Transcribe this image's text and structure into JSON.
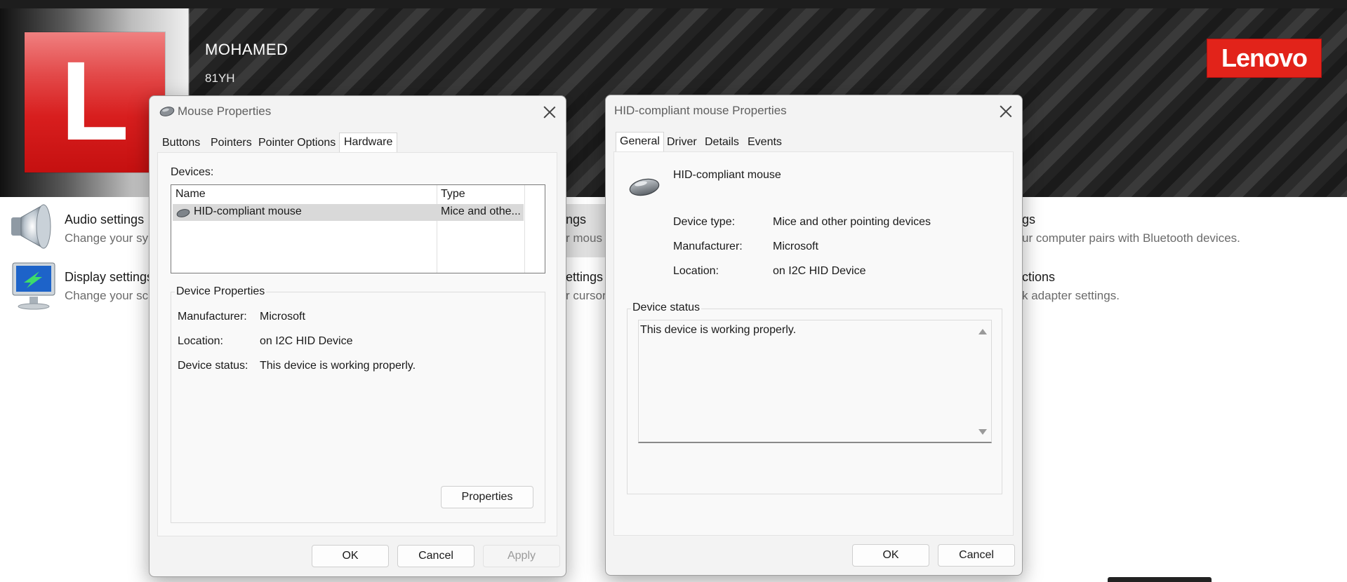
{
  "banner": {
    "logo_letter": "L",
    "pc_name": "MOHAMED",
    "pc_model": "81YH",
    "brand": "Lenovo"
  },
  "settings": {
    "audio": {
      "title": "Audio settings",
      "desc": "Change your sy"
    },
    "display": {
      "title": "Display settings",
      "desc": "Change your sc"
    },
    "mouse": {
      "title_tail": "ngs",
      "desc_tail": "r mous"
    },
    "pointer": {
      "title_tail": "ettings",
      "desc_tail": "r cursor"
    },
    "bluetooth": {
      "title_tail": "gs",
      "desc_tail": "ur computer pairs with Bluetooth devices."
    },
    "network": {
      "title_tail": "ctions",
      "desc_tail": "k adapter settings."
    }
  },
  "mouse_dialog": {
    "title": "Mouse Properties",
    "tabs": [
      "Buttons",
      "Pointers",
      "Pointer Options",
      "Hardware"
    ],
    "active_tab": "Hardware",
    "devices_label": "Devices:",
    "columns": [
      "Name",
      "Type"
    ],
    "rows": [
      {
        "name": "HID-compliant mouse",
        "type": "Mice and othe..."
      }
    ],
    "group_title": "Device Properties",
    "props": [
      {
        "label": "Manufacturer:",
        "value": "Microsoft"
      },
      {
        "label": "Location:",
        "value": "on I2C HID Device"
      },
      {
        "label": "Device status:",
        "value": "This device is working properly."
      }
    ],
    "properties_button": "Properties",
    "ok": "OK",
    "cancel": "Cancel",
    "apply": "Apply"
  },
  "hid_dialog": {
    "title": "HID-compliant mouse Properties",
    "tabs": [
      "General",
      "Driver",
      "Details",
      "Events"
    ],
    "active_tab": "General",
    "device_name": "HID-compliant mouse",
    "props": [
      {
        "label": "Device type:",
        "value": "Mice and other pointing devices"
      },
      {
        "label": "Manufacturer:",
        "value": "Microsoft"
      },
      {
        "label": "Location:",
        "value": "on I2C HID Device"
      }
    ],
    "status_group": "Device status",
    "status_text": "This device is working properly.",
    "ok": "OK",
    "cancel": "Cancel"
  }
}
